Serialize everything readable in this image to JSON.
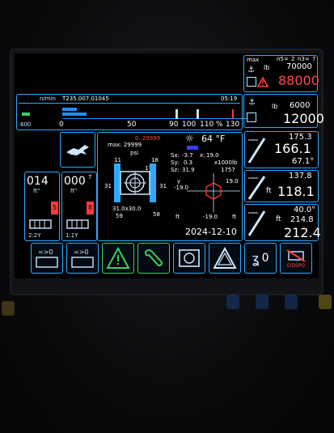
{
  "status": {
    "max_label": "max",
    "n5_label": "n5=",
    "n5_value": "2",
    "n3_label": "n3=",
    "n3_value": "7",
    "lb_unit": "lb",
    "max_load": "70000",
    "current_load": "88000",
    "hook2_unit": "lb",
    "hook2_max": "6000",
    "hook2_current": "12000"
  },
  "scale": {
    "rpm_label": "n/min",
    "code": "T235.007.01045",
    "time": "05:19",
    "left_value": "600",
    "ticks": [
      "0",
      "50",
      "90",
      "100",
      "110",
      "%",
      "130"
    ]
  },
  "center": {
    "range": "0..29999",
    "max_label": "max: 29999",
    "psi_label": "psi",
    "val_11": "11",
    "val_18": "18",
    "val_17": "17",
    "val_31_left": "31",
    "val_31_right": "31",
    "footprint": "31.0x30.0",
    "val_59": "59",
    "val_58": "58",
    "sx_label": "Sx:",
    "sx_value": "-3.7",
    "sy_label": "Sy:",
    "sy_value": "0.3",
    "sz_label": "Sz:",
    "sz_value": "31.9",
    "x_label": "x:",
    "x_value": "19.0",
    "unit_x1000lb": "x1000lb",
    "val_1757": "1757",
    "y_label": "y",
    "y_value": "-19.0",
    "right_val": "19.0",
    "bottom_val": "-19.0",
    "ft_unit": "ft",
    "ft_unit2": "ft",
    "temperature": "64 °F",
    "date": "2024-12-10"
  },
  "left_panels": {
    "a_value": "014",
    "a_unit": "ft\"",
    "a_badge": "5",
    "a_ratio": "2:2Y",
    "b_value": "000",
    "b_sup": "7",
    "b_unit": "ft\"",
    "b_badge": "8",
    "b_ratio": "1:1Y"
  },
  "right_panels": {
    "p1_top": "175.3",
    "p1_main": "166.1",
    "p1_angle": "67.1°",
    "p2_top": "137.8",
    "p2_ft": "ft",
    "p2_main": "118.1",
    "p3_angle": "40.0°",
    "p3_ft": "ft",
    "p3_mid": "214.8",
    "p3_main": "212.4"
  },
  "bottom_bar": {
    "hook_count": "0",
    "eidspo_label": "EIDSPO",
    "tile1_arrow": "=>0",
    "tile2_arrow": "=>0"
  },
  "colors": {
    "accent": "#2fa9ff",
    "warning": "#ff3b3b",
    "ok_green": "#39d15a",
    "hex_red": "#ff3b3b",
    "bar_blue": "#1e8fff"
  }
}
